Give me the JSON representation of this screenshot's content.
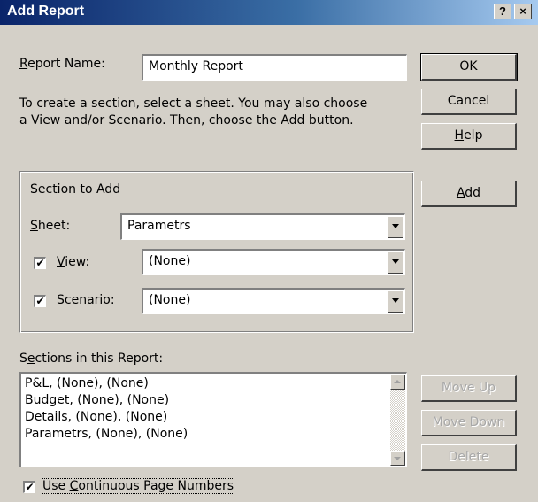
{
  "window": {
    "title": "Add Report",
    "help_button": "?",
    "close_button": "×"
  },
  "report_name": {
    "label_mnemonic": "R",
    "label_rest": "eport Name:",
    "value": "Monthly Report"
  },
  "instructions": [
    "To create a section, select a sheet.  You may also choose",
    "a View and/or Scenario.  Then, choose the Add button."
  ],
  "buttons": {
    "ok": "OK",
    "cancel": "Cancel",
    "help_mnemonic": "H",
    "help_rest": "elp",
    "add_mnemonic": "A",
    "add_rest": "dd",
    "move_up": "Move Up",
    "move_down": "Move Down",
    "delete": "Delete"
  },
  "section_to_add": {
    "group_label": "Section to Add",
    "sheet_label_mnemonic": "S",
    "sheet_label_rest": "heet:",
    "sheet_value": "Parametrs",
    "view_label_mnemonic": "V",
    "view_label_rest": "iew:",
    "view_checked": true,
    "view_value": "(None)",
    "scenario_label_pre": "Sce",
    "scenario_label_mnemonic": "n",
    "scenario_label_post": "ario:",
    "scenario_checked": true,
    "scenario_value": "(None)"
  },
  "sections_list": {
    "label_pre": "S",
    "label_mnemonic": "e",
    "label_post": "ctions in this Report:",
    "items": [
      "P&L, (None), (None)",
      "Budget, (None), (None)",
      "Details, (None), (None)",
      "Parametrs, (None), (None)"
    ]
  },
  "continuous_pages": {
    "checked": true,
    "label_pre": "Use ",
    "label_mnemonic": "C",
    "label_post": "ontinuous Page Numbers"
  },
  "check_glyph": "✔",
  "colors": {
    "dialog_bg": "#d4d0c8",
    "title_start": "#0a246a",
    "title_end": "#a6caf0",
    "disabled_text": "#a8a8a8"
  }
}
